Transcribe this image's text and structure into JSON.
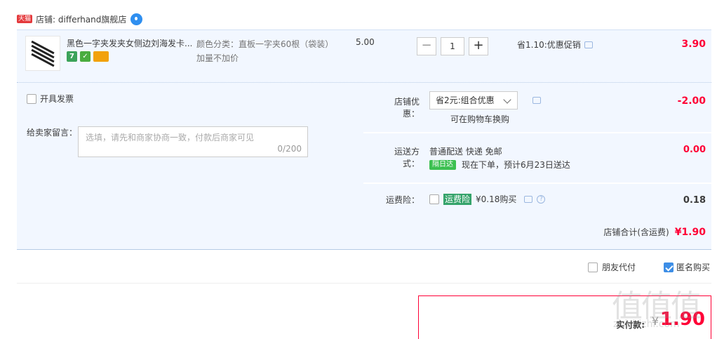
{
  "shop": {
    "tmall_badge": "天猫",
    "name": "店铺: differhand旗舰店"
  },
  "item": {
    "title": "黑色一字夹发夹女侧边刘海发卡...",
    "sku": "颜色分类：直板一字夹60根（袋装）加量不加价",
    "price": "5.00",
    "quantity": "1",
    "qty_minus": "−",
    "qty_plus": "+",
    "promo": "省1.10:优惠促销",
    "total": "3.90",
    "badges": [
      "7",
      "✓",
      ""
    ]
  },
  "invoice": {
    "label": "开具发票"
  },
  "message": {
    "label": "给卖家留言：",
    "placeholder": "选填，请先和商家协商一致，付款后商家可见",
    "count": "0/200"
  },
  "discount": {
    "label": "店铺优惠：",
    "selected": "省2元:组合优惠",
    "note": "可在购物车换购",
    "value": "-2.00"
  },
  "shipping": {
    "label": "运送方式：",
    "method": "普通配送 快递 免邮",
    "tag": "隔日达",
    "eta": "现在下单，预计6月23日送达",
    "value": "0.00"
  },
  "insurance": {
    "label": "运费险：",
    "tag": "运费险",
    "price": "¥0.18购买",
    "value": "0.18"
  },
  "shop_total": {
    "label": "店铺合计(含运费)",
    "value": "¥1.90"
  },
  "friend_pay": {
    "label": "朋友代付"
  },
  "anonymous": {
    "label": "匿名购买"
  },
  "pay": {
    "label": "实付款:",
    "currency": "¥",
    "value": "1.90"
  },
  "watermark": {
    "text": "值值值",
    "url": "zhizhizhi.com"
  },
  "colors": {
    "accent_red": "#ff0036",
    "panel_blue": "#f2f7ff",
    "checkbox_blue": "#3d8ee6"
  }
}
